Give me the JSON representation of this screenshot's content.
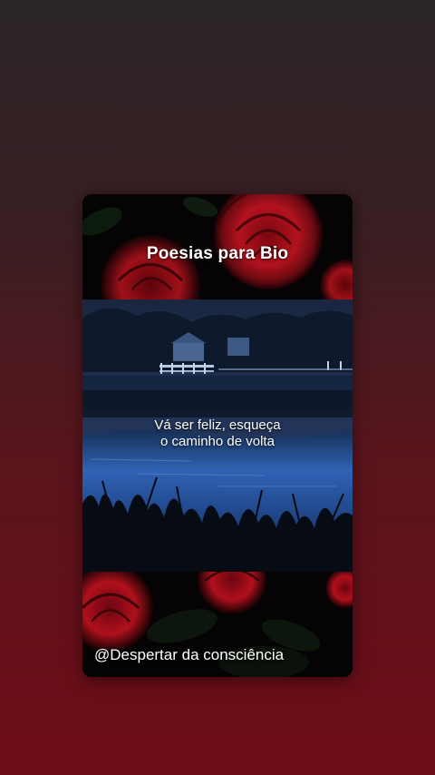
{
  "story": {
    "title": "Poesias para Bio",
    "quote_line1": "Vá ser feliz, esqueça",
    "quote_line2": "o caminho de volta",
    "handle": "@Despertar da consciência"
  },
  "colors": {
    "rose_red": "#b0101c",
    "lake_blue": "#2a5aa8",
    "background_red": "#6e0c16"
  }
}
